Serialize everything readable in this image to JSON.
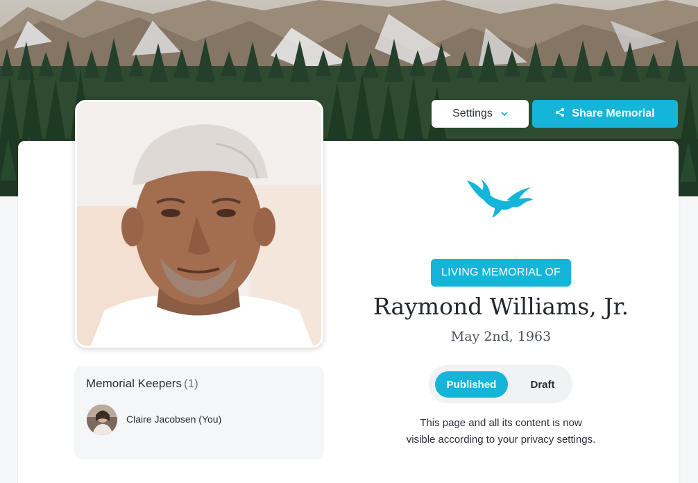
{
  "header": {
    "settings_label": "Settings",
    "share_label": "Share Memorial"
  },
  "memorial": {
    "badge": "LIVING MEMORIAL OF",
    "name": "Raymond Williams, Jr.",
    "date": "May 2nd, 1963"
  },
  "status": {
    "published_label": "Published",
    "draft_label": "Draft",
    "selected": "Published",
    "line1": "This page and all its content is now",
    "line2": "visible according to your privacy settings."
  },
  "keepers": {
    "title": "Memorial Keepers",
    "count": "(1)",
    "items": [
      {
        "name": "Claire Jacobsen (You)"
      }
    ]
  },
  "colors": {
    "accent": "#14b5d9",
    "card": "#ffffff",
    "panel": "#f5f6f8"
  },
  "icons": {
    "settings_chevron": "chevron-down-icon",
    "share": "share-icon",
    "emblem": "eagle-icon"
  }
}
